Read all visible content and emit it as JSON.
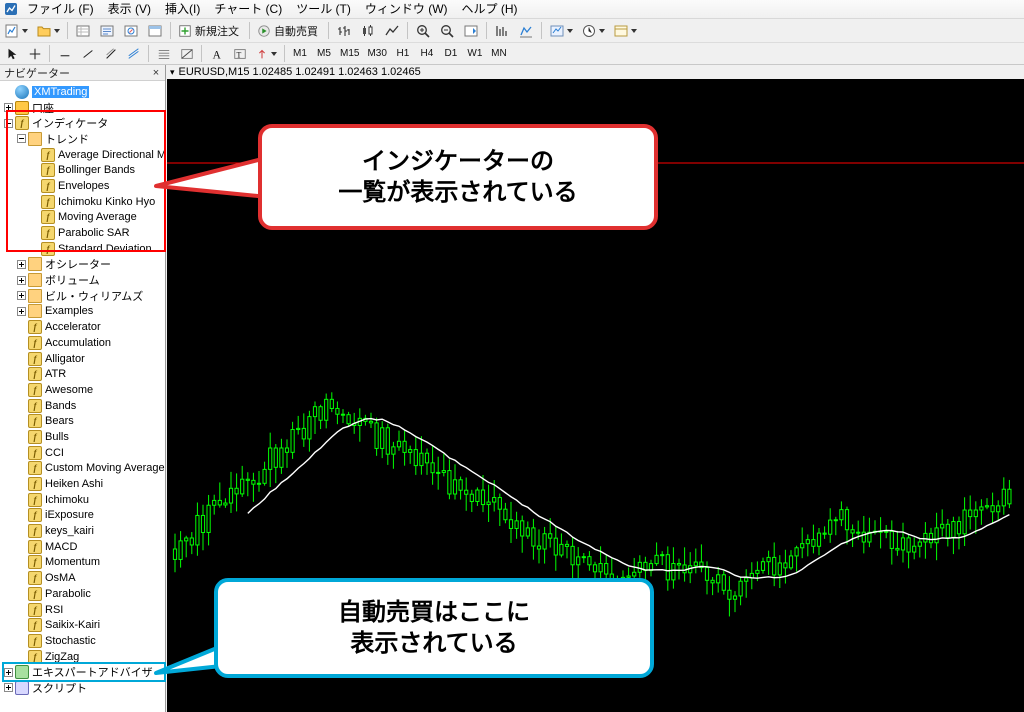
{
  "menubar": {
    "app_icon": "chart-app-icon",
    "items": [
      "ファイル (F)",
      "表示 (V)",
      "挿入(I)",
      "チャート (C)",
      "ツール (T)",
      "ウィンドウ (W)",
      "ヘルプ (H)"
    ]
  },
  "toolbar": {
    "new_order_label": "新規注文",
    "autotrading_label": "自動売買",
    "periods": [
      "M1",
      "M5",
      "M15",
      "M30",
      "H1",
      "H4",
      "D1",
      "W1",
      "MN"
    ],
    "icons": [
      "new-chart-icon",
      "open-profile-icon",
      "save-icon",
      "print-icon",
      "bar-chart-icon",
      "candlestick-chart-icon",
      "line-chart-icon",
      "zoom-in-icon",
      "zoom-out-icon",
      "auto-scroll-icon",
      "data-window-icon",
      "navigator-icon",
      "terminal-icon",
      "indicators-icon",
      "periods-icon",
      "templates-icon",
      "cursor-icon",
      "crosshair-icon",
      "vline-icon",
      "trendline-icon",
      "equidistant-channel-icon",
      "fibonacci-icon",
      "text-icon",
      "label-icon",
      "shapes-icon"
    ]
  },
  "navigator": {
    "title": "ナビゲーター",
    "close_label": "×",
    "items": [
      {
        "label": "XMTrading",
        "indent": 0,
        "icon": "globe-icon",
        "expander": "none",
        "selected": true
      },
      {
        "label": "口座",
        "indent": 0,
        "icon": "account-icon",
        "expander": "plus",
        "selected": false
      },
      {
        "label": "インディケータ",
        "indent": 0,
        "icon": "indicator-icon",
        "expander": "minus",
        "selected": false
      },
      {
        "label": "トレンド",
        "indent": 1,
        "icon": "folder-icon",
        "expander": "minus",
        "selected": false
      },
      {
        "label": "Average Directional Movement Index",
        "indent": 2,
        "icon": "indicator-icon",
        "expander": "none",
        "selected": false
      },
      {
        "label": "Bollinger Bands",
        "indent": 2,
        "icon": "indicator-icon",
        "expander": "none",
        "selected": false
      },
      {
        "label": "Envelopes",
        "indent": 2,
        "icon": "indicator-icon",
        "expander": "none",
        "selected": false
      },
      {
        "label": "Ichimoku Kinko Hyo",
        "indent": 2,
        "icon": "indicator-icon",
        "expander": "none",
        "selected": false
      },
      {
        "label": "Moving Average",
        "indent": 2,
        "icon": "indicator-icon",
        "expander": "none",
        "selected": false
      },
      {
        "label": "Parabolic SAR",
        "indent": 2,
        "icon": "indicator-icon",
        "expander": "none",
        "selected": false
      },
      {
        "label": "Standard Deviation",
        "indent": 2,
        "icon": "indicator-icon",
        "expander": "none",
        "selected": false
      },
      {
        "label": "オシレーター",
        "indent": 1,
        "icon": "folder-icon",
        "expander": "plus",
        "selected": false
      },
      {
        "label": "ボリューム",
        "indent": 1,
        "icon": "folder-icon",
        "expander": "plus",
        "selected": false
      },
      {
        "label": "ビル・ウィリアムズ",
        "indent": 1,
        "icon": "folder-icon",
        "expander": "plus",
        "selected": false
      },
      {
        "label": "Examples",
        "indent": 1,
        "icon": "folder-icon",
        "expander": "plus",
        "selected": false
      },
      {
        "label": "Accelerator",
        "indent": 1,
        "icon": "indicator-icon",
        "expander": "none",
        "selected": false
      },
      {
        "label": "Accumulation",
        "indent": 1,
        "icon": "indicator-icon",
        "expander": "none",
        "selected": false
      },
      {
        "label": "Alligator",
        "indent": 1,
        "icon": "indicator-icon",
        "expander": "none",
        "selected": false
      },
      {
        "label": "ATR",
        "indent": 1,
        "icon": "indicator-icon",
        "expander": "none",
        "selected": false
      },
      {
        "label": "Awesome",
        "indent": 1,
        "icon": "indicator-icon",
        "expander": "none",
        "selected": false
      },
      {
        "label": "Bands",
        "indent": 1,
        "icon": "indicator-icon",
        "expander": "none",
        "selected": false
      },
      {
        "label": "Bears",
        "indent": 1,
        "icon": "indicator-icon",
        "expander": "none",
        "selected": false
      },
      {
        "label": "Bulls",
        "indent": 1,
        "icon": "indicator-icon",
        "expander": "none",
        "selected": false
      },
      {
        "label": "CCI",
        "indent": 1,
        "icon": "indicator-icon",
        "expander": "none",
        "selected": false
      },
      {
        "label": "Custom Moving Average",
        "indent": 1,
        "icon": "indicator-icon",
        "expander": "none",
        "selected": false
      },
      {
        "label": "Heiken Ashi",
        "indent": 1,
        "icon": "indicator-icon",
        "expander": "none",
        "selected": false
      },
      {
        "label": "Ichimoku",
        "indent": 1,
        "icon": "indicator-icon",
        "expander": "none",
        "selected": false
      },
      {
        "label": "iExposure",
        "indent": 1,
        "icon": "indicator-icon",
        "expander": "none",
        "selected": false
      },
      {
        "label": "keys_kairi",
        "indent": 1,
        "icon": "indicator-icon",
        "expander": "none",
        "selected": false
      },
      {
        "label": "MACD",
        "indent": 1,
        "icon": "indicator-icon",
        "expander": "none",
        "selected": false
      },
      {
        "label": "Momentum",
        "indent": 1,
        "icon": "indicator-icon",
        "expander": "none",
        "selected": false
      },
      {
        "label": "OsMA",
        "indent": 1,
        "icon": "indicator-icon",
        "expander": "none",
        "selected": false
      },
      {
        "label": "Parabolic",
        "indent": 1,
        "icon": "indicator-icon",
        "expander": "none",
        "selected": false
      },
      {
        "label": "RSI",
        "indent": 1,
        "icon": "indicator-icon",
        "expander": "none",
        "selected": false
      },
      {
        "label": "Saikix-Kairi",
        "indent": 1,
        "icon": "indicator-icon",
        "expander": "none",
        "selected": false
      },
      {
        "label": "Stochastic",
        "indent": 1,
        "icon": "indicator-icon",
        "expander": "none",
        "selected": false
      },
      {
        "label": "ZigZag",
        "indent": 1,
        "icon": "indicator-icon",
        "expander": "none",
        "selected": false
      },
      {
        "label": "エキスパートアドバイザ",
        "indent": 0,
        "icon": "expert-icon",
        "expander": "plus",
        "selected": false
      },
      {
        "label": "スクリプト",
        "indent": 0,
        "icon": "script-icon",
        "expander": "plus",
        "selected": false
      }
    ]
  },
  "chart": {
    "titlebar": "EURUSD,M15  1.02485 1.02491 1.02463 1.02465",
    "symbol": "EURUSD",
    "timeframe": "M15",
    "ohlc": {
      "open": "1.02485",
      "high": "1.02491",
      "low": "1.02463",
      "close": "1.02465"
    },
    "bull_color": "#00ff00",
    "bear_color": "#00ff00",
    "background": "#000000",
    "ma_line_color": "#ffffff",
    "price_line_color": "#ff0000"
  },
  "callouts": [
    {
      "id": "indicator-list-callout",
      "line1": "インジケーターの",
      "line2": "一覧が表示されている",
      "border_color": "#e03030"
    },
    {
      "id": "expert-advisor-callout",
      "line1": "自動売買はここに",
      "line2": "表示されている",
      "border_color": "#00a8d8"
    }
  ],
  "highlights": [
    {
      "id": "indicator-tree-highlight",
      "color": "#ff0000"
    },
    {
      "id": "expert-advisor-highlight",
      "color": "#00a8d8"
    }
  ]
}
